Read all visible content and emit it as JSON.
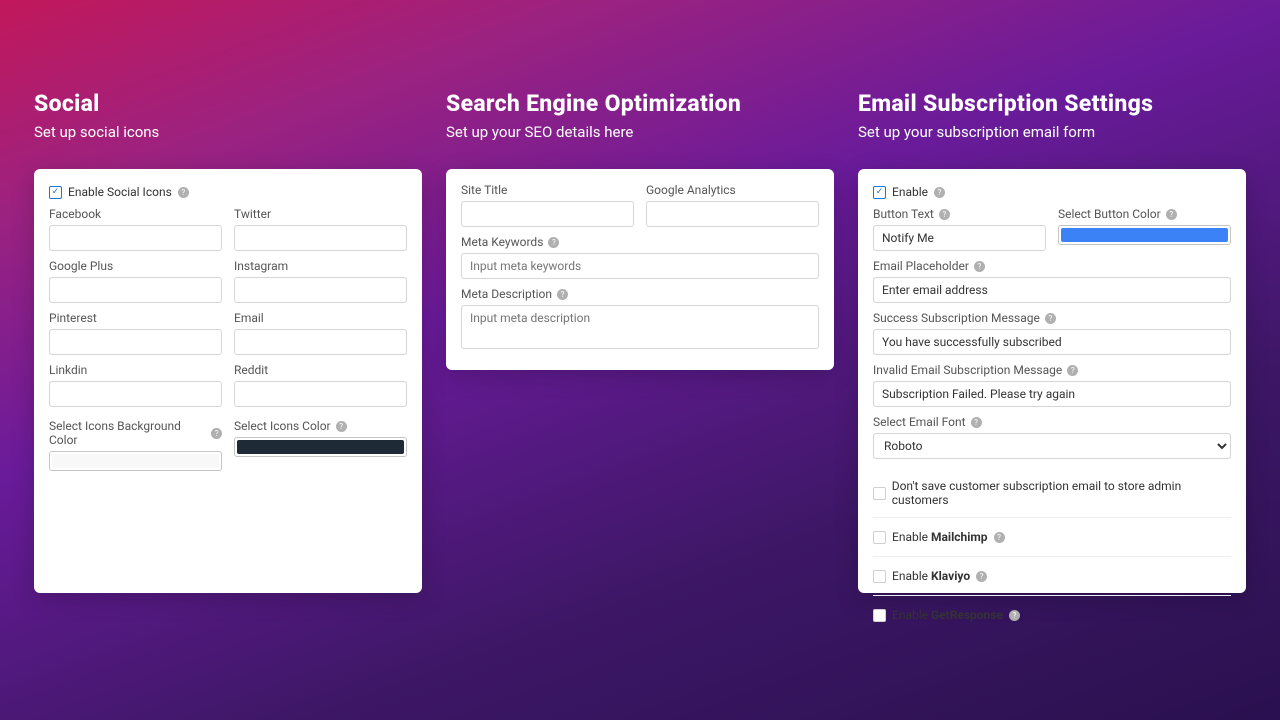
{
  "social": {
    "title": "Social",
    "subtitle": "Set up social icons",
    "enable_label": "Enable Social Icons",
    "facebook": "Facebook",
    "twitter": "Twitter",
    "google_plus": "Google Plus",
    "instagram": "Instagram",
    "pinterest": "Pinterest",
    "email": "Email",
    "linkedin": "Linkdin",
    "reddit": "Reddit",
    "bg_color_label": "Select Icons Background Color",
    "icons_color_label": "Select Icons Color"
  },
  "seo": {
    "title": "Search Engine Optimization",
    "subtitle": "Set up your SEO details here",
    "site_title": "Site Title",
    "google_analytics": "Google Analytics",
    "meta_keywords": "Meta Keywords",
    "meta_keywords_placeholder": "Input meta keywords",
    "meta_description": "Meta Description",
    "meta_description_placeholder": "Input meta description"
  },
  "email": {
    "title": "Email Subscription Settings",
    "subtitle": "Set up your subscription email form",
    "enable_label": "Enable",
    "button_text_label": "Button Text",
    "button_text_value": "Notify Me",
    "select_color_label": "Select Button Color",
    "placeholder_label": "Email Placeholder",
    "placeholder_value": "Enter email address",
    "success_label": "Success Subscription Message",
    "success_value": "You have successfully subscribed",
    "invalid_label": "Invalid Email Subscription Message",
    "invalid_value": "Subscription Failed. Please try again",
    "font_label": "Select Email Font",
    "font_value": "Roboto",
    "dont_save": "Don't save customer subscription email to store admin customers",
    "enable_word": "Enable ",
    "mailchimp": "Mailchimp",
    "klaviyo": "Klaviyo",
    "getresponse": "GetResponse"
  }
}
